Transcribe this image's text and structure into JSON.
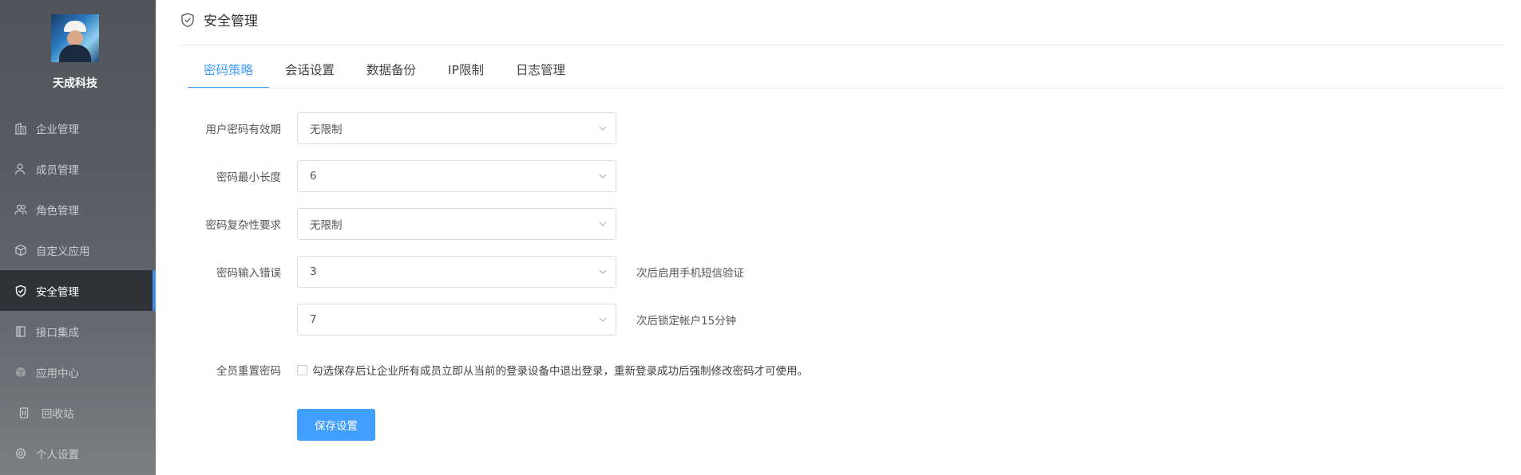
{
  "sidebar": {
    "company_name": "天成科技",
    "items": [
      {
        "label": "企业管理",
        "icon": "building-icon"
      },
      {
        "label": "成员管理",
        "icon": "user-icon"
      },
      {
        "label": "角色管理",
        "icon": "users-icon"
      },
      {
        "label": "自定义应用",
        "icon": "cube-icon"
      },
      {
        "label": "安全管理",
        "icon": "shield-icon",
        "active": true
      },
      {
        "label": "接口集成",
        "icon": "panel-icon"
      },
      {
        "label": "应用中心",
        "icon": "box-icon"
      },
      {
        "label": "回收站",
        "icon": "trash-icon"
      },
      {
        "label": "个人设置",
        "icon": "gear-icon"
      }
    ]
  },
  "header": {
    "title": "安全管理",
    "icon": "shield-icon"
  },
  "tabs": [
    {
      "label": "密码策略",
      "active": true
    },
    {
      "label": "会话设置"
    },
    {
      "label": "数据备份"
    },
    {
      "label": "IP限制"
    },
    {
      "label": "日志管理"
    }
  ],
  "form": {
    "password_validity": {
      "label": "用户密码有效期",
      "value": "无限制"
    },
    "min_length": {
      "label": "密码最小长度",
      "value": "6"
    },
    "complexity": {
      "label": "密码复杂性要求",
      "value": "无限制"
    },
    "error_sms": {
      "label": "密码输入错误",
      "value": "3",
      "suffix": "次后启用手机短信验证"
    },
    "error_lock": {
      "label": "",
      "value": "7",
      "suffix": "次后锁定帐户15分钟"
    },
    "reset_all": {
      "label": "全员重置密码",
      "text": "勾选保存后让企业所有成员立即从当前的登录设备中退出登录，重新登录成功后强制修改密码才可使用。",
      "checked": false
    },
    "save_label": "保存设置"
  },
  "colors": {
    "accent": "#409eff",
    "sidebar_active_bg": "#2f3338"
  }
}
